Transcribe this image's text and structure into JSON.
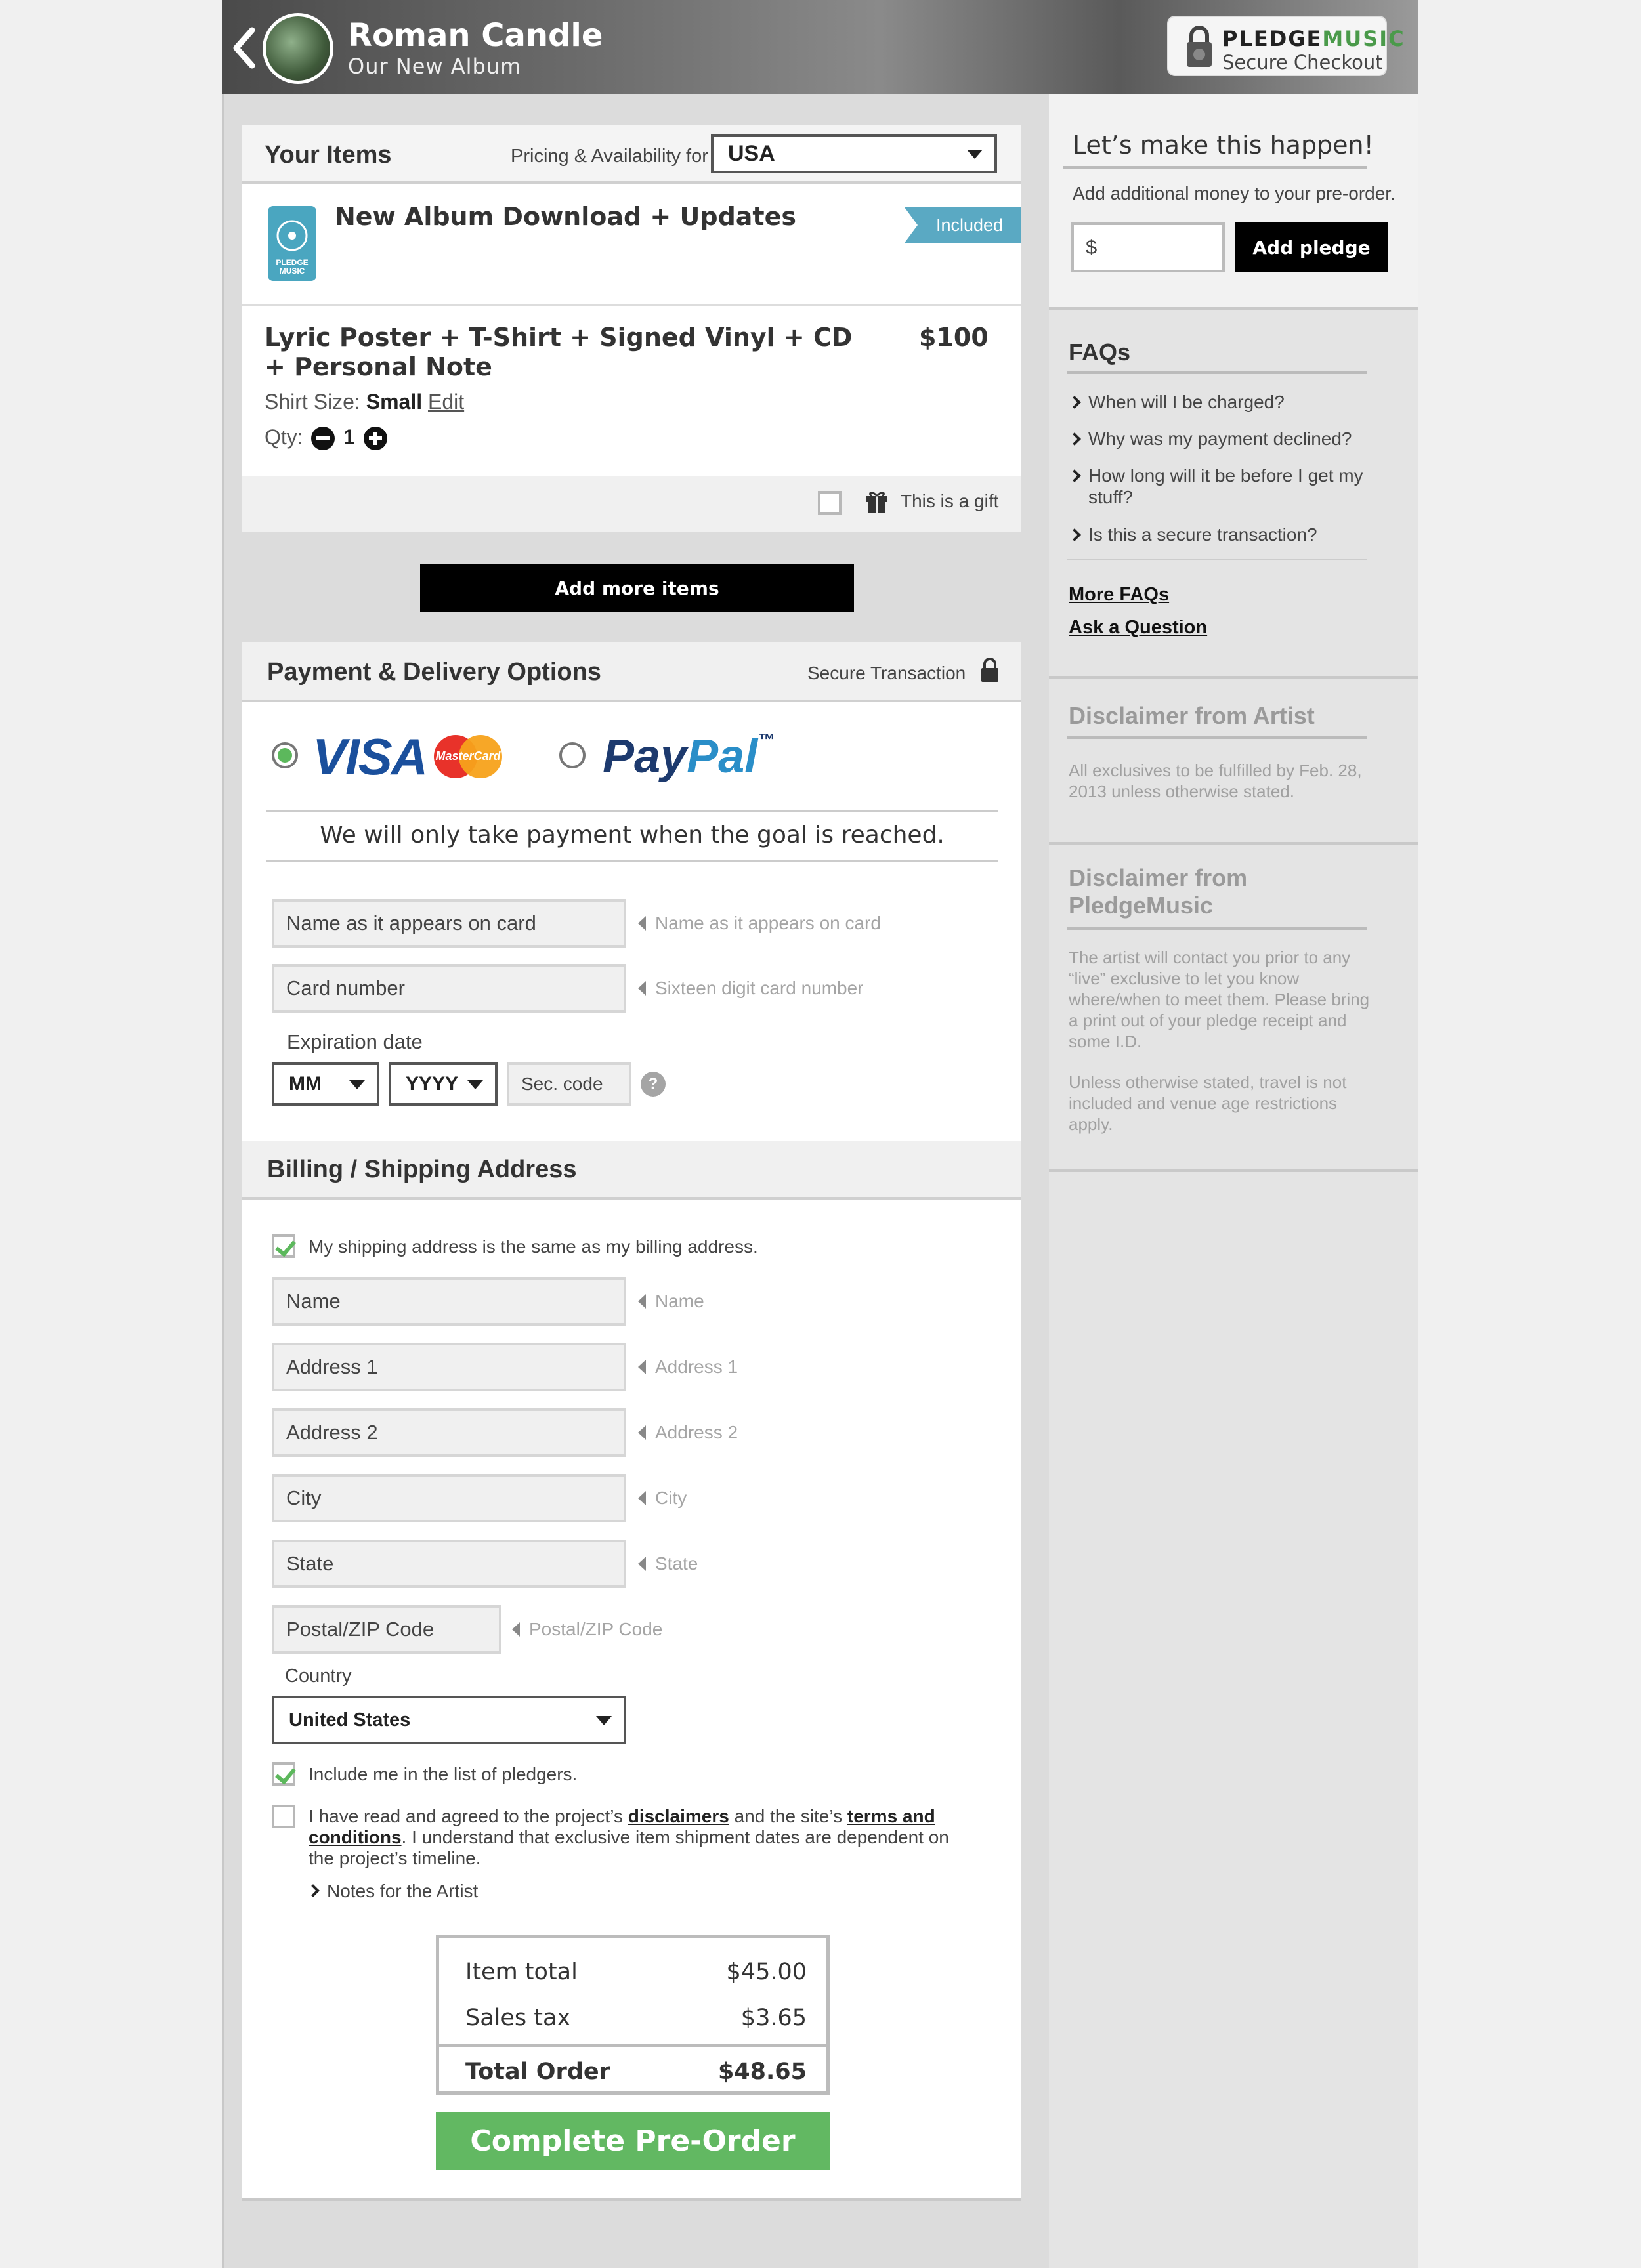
{
  "header": {
    "artist_name": "Roman Candle",
    "album_title": "Our New Album",
    "brand_part1": "PLEDGE",
    "brand_part2": "MUSIC",
    "brand_sub": "Secure Checkout"
  },
  "items": {
    "title": "Your Items",
    "pricing_label": "Pricing & Availability for",
    "country_selected": "USA",
    "item1": {
      "name": "New Album Download + Updates",
      "tag": "Included",
      "logo_text1": "PLEDGE",
      "logo_text2": "MUSIC"
    },
    "item2": {
      "name_line1": "Lyric Poster + T-Shirt + Signed Vinyl + CD",
      "name_line2": "+ Personal Note",
      "price": "$100",
      "shirt_label": "Shirt Size:",
      "shirt_value": "Small",
      "edit_label": "Edit",
      "qty_label": "Qty:",
      "qty_value": "1"
    },
    "gift_label": "This is a gift",
    "add_more_label": "Add more items"
  },
  "payment": {
    "title": "Payment & Delivery Options",
    "secure_label": "Secure Transaction",
    "visa_text": "VISA",
    "mastercard_text": "MasterCard",
    "paypal_text1": "Pay",
    "paypal_text2": "Pal",
    "tm": "™",
    "goal_note": "We will only take payment when the goal is reached.",
    "name_placeholder": "Name as it appears on card",
    "name_hint": "Name as it appears on card",
    "card_placeholder": "Card number",
    "card_hint": "Sixteen digit card number",
    "expiration_label": "Expiration date",
    "month_value": "MM",
    "year_value": "YYYY",
    "sec_code_placeholder": "Sec. code",
    "help_glyph": "?"
  },
  "billing": {
    "title": "Billing / Shipping Address",
    "same_address_label": "My shipping address is the same as my billing address.",
    "fields": [
      {
        "placeholder": "Name",
        "hint": "Name"
      },
      {
        "placeholder": "Address 1",
        "hint": "Address 1"
      },
      {
        "placeholder": "Address 2",
        "hint": "Address 2"
      },
      {
        "placeholder": "City",
        "hint": "City"
      },
      {
        "placeholder": "State",
        "hint": "State"
      }
    ],
    "zip_placeholder": "Postal/ZIP Code",
    "zip_hint": "Postal/ZIP Code",
    "country_label": "Country",
    "country_value": "United States",
    "pledgers_label": "Include me in the list of pledgers.",
    "terms_p1": "I have read and agreed to the project’s ",
    "terms_link1": "disclaimers",
    "terms_p2": " and the site’s ",
    "terms_link2": "terms and conditions",
    "terms_p3": ". I understand that exclusive item shipment dates are dependent on the project’s timeline.",
    "notes_label": "Notes for the Artist"
  },
  "totals": {
    "item_total_label": "Item total",
    "item_total_value": "$45.00",
    "tax_label": "Sales tax",
    "tax_value": "$3.65",
    "order_label": "Total Order",
    "order_value": "$48.65",
    "complete_label": "Complete Pre-Order"
  },
  "sidebar": {
    "pledge_title": "Let’s make this happen!",
    "pledge_sub": "Add additional money to your pre-order.",
    "currency_symbol": "$",
    "add_pledge_label": "Add pledge",
    "faqs_title": "FAQs",
    "faqs": [
      "When will I be charged?",
      "Why was my payment declined?",
      "How long will it be before I get my stuff?",
      "Is this a secure transaction?"
    ],
    "more_faqs": "More FAQs",
    "ask_question": "Ask a Question",
    "artist_disclaimer_title": "Disclaimer from Artist",
    "artist_disclaimer_text": "All exclusives to be fulfilled by Feb. 28, 2013 unless otherwise stated.",
    "pm_disclaimer_title1": "Disclaimer from",
    "pm_disclaimer_title2": "PledgeMusic",
    "pm_disclaimer_text1": "The artist will contact you prior to any “live” exclusive to let you know where/when to meet them. Please bring a print out of your pledge receipt and some I.D.",
    "pm_disclaimer_text2": "Unless otherwise stated, travel is not included and venue age restrictions apply."
  },
  "colors": {
    "accent_green": "#62b862",
    "included_tag": "#5aa9c3",
    "visa_blue": "#1a4f9c",
    "paypal_dark": "#1d3a6e",
    "paypal_light": "#2a8ec8"
  }
}
